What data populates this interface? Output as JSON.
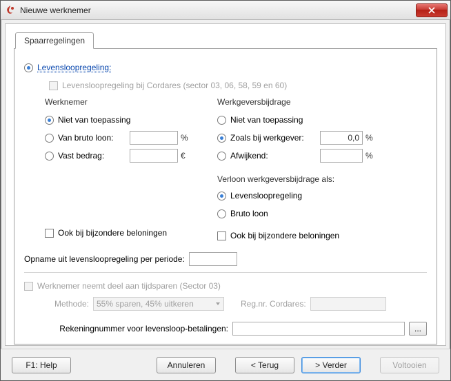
{
  "window": {
    "title": "Nieuwe werknemer"
  },
  "tabs": {
    "spaarregelingen": "Spaarregelingen"
  },
  "main_option_label": "Levensloopregeling:",
  "cordares_sector": "Levensloopregeling bij Cordares (sector 03, 06, 58, 59 en 60)",
  "werknemer": {
    "heading": "Werknemer",
    "nvt": "Niet van toepassing",
    "bruto": "Van bruto loon:",
    "vast": "Vast bedrag:",
    "bruto_value": "",
    "vast_value": "",
    "pct": "%",
    "eur": "€",
    "ook_bij": "Ook bij bijzondere beloningen"
  },
  "werkgever": {
    "heading": "Werkgeversbijdrage",
    "nvt": "Niet van toepassing",
    "zoals": "Zoals bij werkgever:",
    "afwijkend": "Afwijkend:",
    "zoals_value": "0,0",
    "afwijkend_value": "",
    "pct": "%",
    "verloon_heading": "Verloon werkgeversbijdrage als:",
    "opt_levensloop": "Levensloopregeling",
    "opt_bruto": "Bruto loon",
    "ook_bij": "Ook bij bijzondere beloningen"
  },
  "opname_label": "Opname uit levensloopregeling per periode:",
  "opname_value": "",
  "tijdsparen_label": "Werknemer neemt deel aan tijdsparen (Sector 03)",
  "methode_label": "Methode:",
  "methode_value": "55% sparen, 45% uitkeren",
  "regnr_label": "Reg.nr. Cordares:",
  "regnr_value": "",
  "rekening_label": "Rekeningnummer voor levensloop-betalingen:",
  "rekening_value": "",
  "dots": "...",
  "buttons": {
    "help": "F1: Help",
    "annuleren": "Annuleren",
    "terug": "< Terug",
    "verder": "> Verder",
    "voltooien": "Voltooien"
  }
}
